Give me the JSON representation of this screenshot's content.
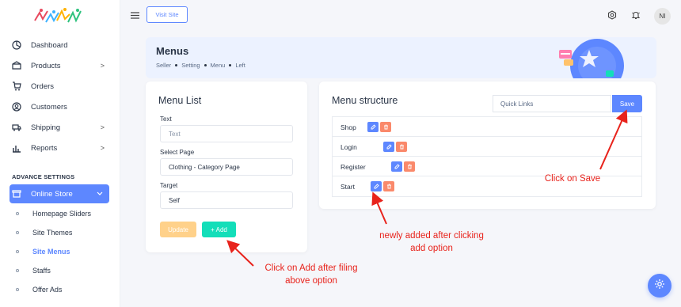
{
  "sidebar": {
    "nav": [
      {
        "label": "Dashboard",
        "icon": "dashboard-icon",
        "chevron": ""
      },
      {
        "label": "Products",
        "icon": "products-icon",
        "chevron": ">"
      },
      {
        "label": "Orders",
        "icon": "orders-icon",
        "chevron": ""
      },
      {
        "label": "Customers",
        "icon": "customers-icon",
        "chevron": ""
      },
      {
        "label": "Shipping",
        "icon": "shipping-icon",
        "chevron": ">"
      },
      {
        "label": "Reports",
        "icon": "reports-icon",
        "chevron": ">"
      }
    ],
    "section_title": "ADVANCE SETTINGS",
    "active_item": {
      "label": "Online Store",
      "icon": "store-icon"
    },
    "sub_items": [
      {
        "label": "Homepage Sliders",
        "active": false
      },
      {
        "label": "Site Themes",
        "active": false
      },
      {
        "label": "Site Menus",
        "active": true
      },
      {
        "label": "Staffs",
        "active": false
      },
      {
        "label": "Offer Ads",
        "active": false
      }
    ]
  },
  "header": {
    "visit_site_label": "Visit Site",
    "avatar_initials": "NI"
  },
  "banner": {
    "title": "Menus",
    "breadcrumbs": [
      "Seller",
      "Setting",
      "Menu",
      "Left"
    ]
  },
  "menu_list_card": {
    "title": "Menu List",
    "text_label": "Text",
    "text_placeholder": "Text",
    "select_page_label": "Select Page",
    "select_page_value": "Clothing - Category Page",
    "target_label": "Target",
    "target_value": "Self",
    "update_label": "Update",
    "add_label": "+ Add"
  },
  "menu_structure_card": {
    "title": "Menu structure",
    "quick_links_value": "Quick Links",
    "save_label": "Save",
    "rows": [
      {
        "label": "Shop"
      },
      {
        "label": "Login"
      },
      {
        "label": "Register"
      },
      {
        "label": "Start"
      }
    ]
  },
  "annotations": {
    "save": "Click on Save",
    "newly_added_line1": "newly added after clicking",
    "newly_added_line2": "add option",
    "add_line1": "Click on Add after filing",
    "add_line2": "above option"
  },
  "colors": {
    "primary": "#5d87ff",
    "success": "#13deb9",
    "warning": "#ffd18a",
    "danger": "#fa896b",
    "annotation": "#e8231c"
  }
}
